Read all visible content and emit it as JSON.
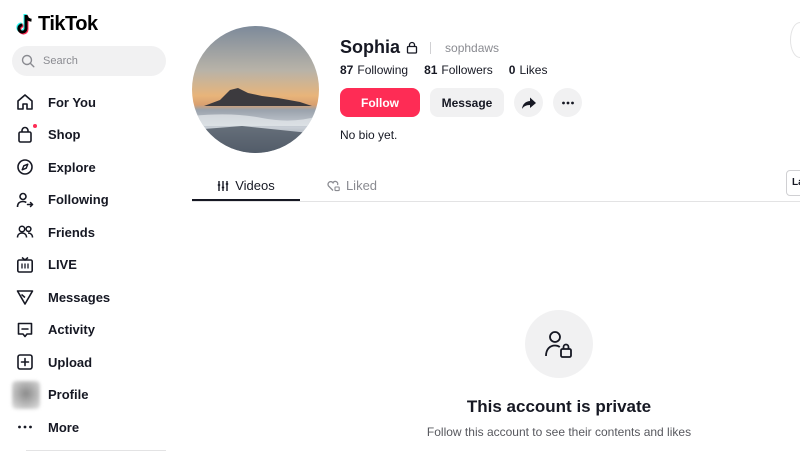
{
  "app": {
    "logo_text": "TikTok",
    "accent_color": "#fe2c55"
  },
  "search": {
    "placeholder": "Search"
  },
  "sidebar": {
    "items": [
      {
        "label": "For You",
        "icon": "home-icon"
      },
      {
        "label": "Shop",
        "icon": "shop-bag-icon"
      },
      {
        "label": "Explore",
        "icon": "compass-icon"
      },
      {
        "label": "Following",
        "icon": "user-following-icon"
      },
      {
        "label": "Friends",
        "icon": "friends-icon"
      },
      {
        "label": "LIVE",
        "icon": "live-tv-icon"
      },
      {
        "label": "Messages",
        "icon": "paper-plane-icon"
      },
      {
        "label": "Activity",
        "icon": "activity-message-icon"
      },
      {
        "label": "Upload",
        "icon": "plus-square-icon"
      },
      {
        "label": "Profile",
        "icon": "avatar"
      },
      {
        "label": "More",
        "icon": "ellipsis-icon"
      }
    ]
  },
  "profile": {
    "name": "Sophia",
    "handle": "sophdaws",
    "stats": {
      "following_count": "87",
      "following_label": "Following",
      "followers_count": "81",
      "followers_label": "Followers",
      "likes_count": "0",
      "likes_label": "Likes"
    },
    "follow_label": "Follow",
    "message_label": "Message",
    "bio": "No bio yet."
  },
  "tabs": {
    "videos": "Videos",
    "liked": "Liked",
    "side_button": "La"
  },
  "private": {
    "title": "This account is private",
    "subtitle": "Follow this account to see their contents and likes"
  }
}
